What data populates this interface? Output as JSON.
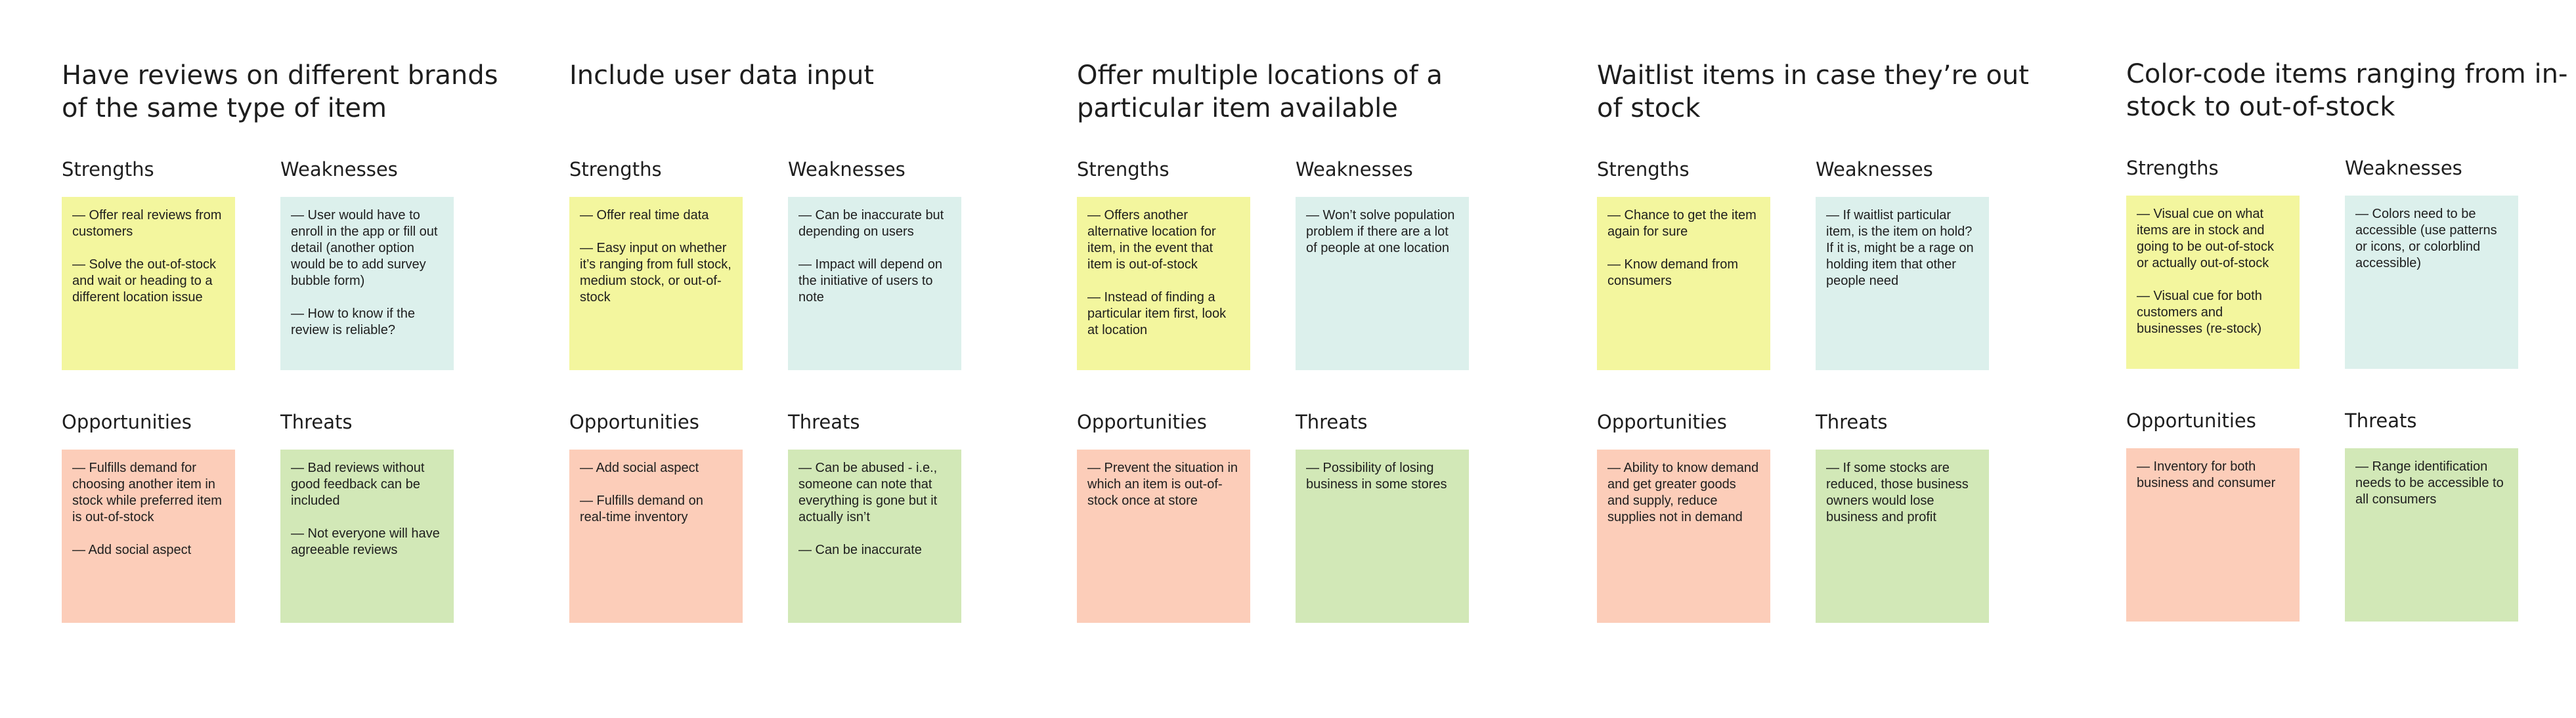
{
  "colors": {
    "strengths": "#f3f69e",
    "weaknesses": "#dcf0ec",
    "opportunities": "#fccdb9",
    "threats": "#d2e8b7",
    "text": "#1e1e1e",
    "background": "#ffffff"
  },
  "labels": {
    "strengths": "Strengths",
    "weaknesses": "Weaknesses",
    "opportunities": "Opportunities",
    "threats": "Threats"
  },
  "boards": [
    {
      "title": "Have reviews on different brands of the same type of item",
      "strengths": [
        "— Offer real reviews from customers",
        "— Solve the out-of-stock and wait or heading to a different location issue"
      ],
      "weaknesses": [
        "— User would have to enroll in the app or fill out detail (another option would be to add survey bubble form)",
        "— How to know if the review is reliable?"
      ],
      "opportunities": [
        "— Fulfills demand for choosing another item in stock while preferred item is out-of-stock",
        "— Add social aspect"
      ],
      "threats": [
        "— Bad reviews without good feedback can be included",
        "— Not everyone will have agreeable reviews"
      ]
    },
    {
      "title": "Include user data input",
      "strengths": [
        "— Offer real time data",
        "— Easy input on whether it’s ranging from full stock, medium stock, or out-of-stock"
      ],
      "weaknesses": [
        "— Can be inaccurate but depending on users",
        "— Impact will depend on the initiative of users to note"
      ],
      "opportunities": [
        "—  Add social aspect",
        "— Fulfills demand on real-time inventory"
      ],
      "threats": [
        "— Can be abused - i.e., someone can note that everything is gone but it actually isn’t",
        "— Can be inaccurate"
      ]
    },
    {
      "title": "Offer multiple locations of a particular item available",
      "strengths": [
        "—  Offers another alternative location for item,  in the event that item is out-of-stock",
        "— Instead of finding a particular item first, look at location"
      ],
      "weaknesses": [
        "— Won’t solve population problem if there are a lot of people at one location"
      ],
      "opportunities": [
        "— Prevent the situation in which an item is  out-of-stock once at store"
      ],
      "threats": [
        "— Possibility of losing business in some stores"
      ]
    },
    {
      "title": "Waitlist items in case they’re out of stock",
      "strengths": [
        "— Chance to get the item again for sure",
        "— Know demand from consumers"
      ],
      "weaknesses": [
        "— If waitlist particular item, is the item on hold? If it is, might be a rage on holding  item that other people need"
      ],
      "opportunities": [
        "— Ability to know demand and get greater goods and supply, reduce supplies not in demand"
      ],
      "threats": [
        "— If some stocks are reduced, those business owners would lose business and profit"
      ]
    },
    {
      "title": "Color-code items ranging from in-stock to out-of-stock",
      "strengths": [
        "— Visual cue on what items are in stock and going to be out-of-stock or actually out-of-stock",
        "— Visual cue for both customers and businesses (re-stock)"
      ],
      "weaknesses": [
        "— Colors need to be accessible (use patterns or icons, or colorblind accessible)"
      ],
      "opportunities": [
        "— Inventory for both business and consumer"
      ],
      "threats": [
        "— Range identification needs to be accessible to all consumers"
      ]
    }
  ]
}
